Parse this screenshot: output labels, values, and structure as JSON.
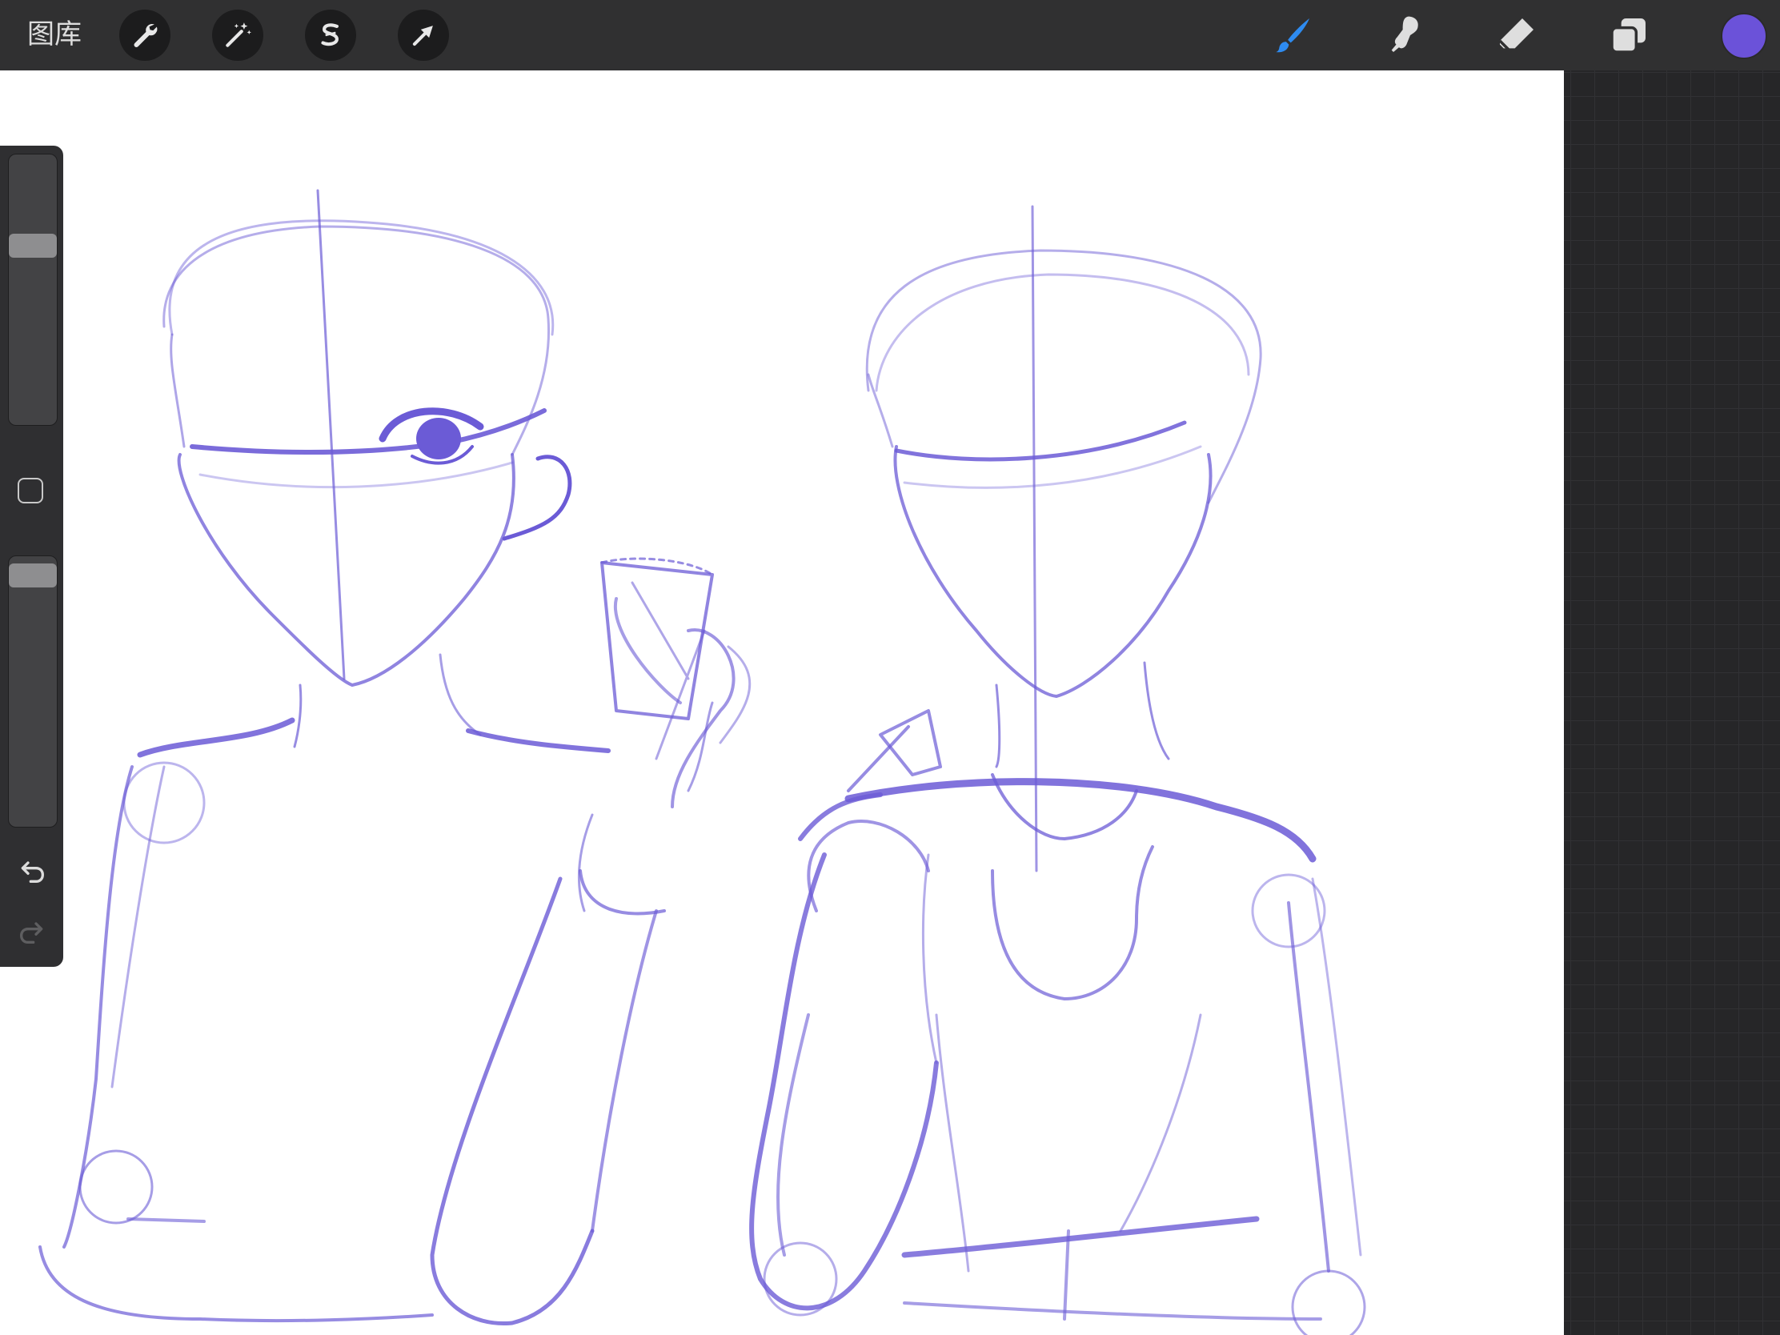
{
  "topbar": {
    "gallery_label": "图库",
    "left_tools": [
      {
        "name": "actions-wrench-icon"
      },
      {
        "name": "adjustments-magic-wand-icon"
      },
      {
        "name": "selection-s-icon"
      },
      {
        "name": "transform-arrow-icon"
      }
    ],
    "right_tools": [
      {
        "name": "brush-icon",
        "active": true
      },
      {
        "name": "smudge-icon",
        "active": false
      },
      {
        "name": "eraser-icon",
        "active": false
      },
      {
        "name": "layers-icon",
        "active": false
      }
    ],
    "current_color": "#6b52d9"
  },
  "sidebar": {
    "brush_size": 0.68,
    "brush_opacity": 0.97
  },
  "colors": {
    "sketch_stroke": "#6b5bd6",
    "active_tool": "#2e8bf0",
    "inactive_tool": "#dedede"
  }
}
